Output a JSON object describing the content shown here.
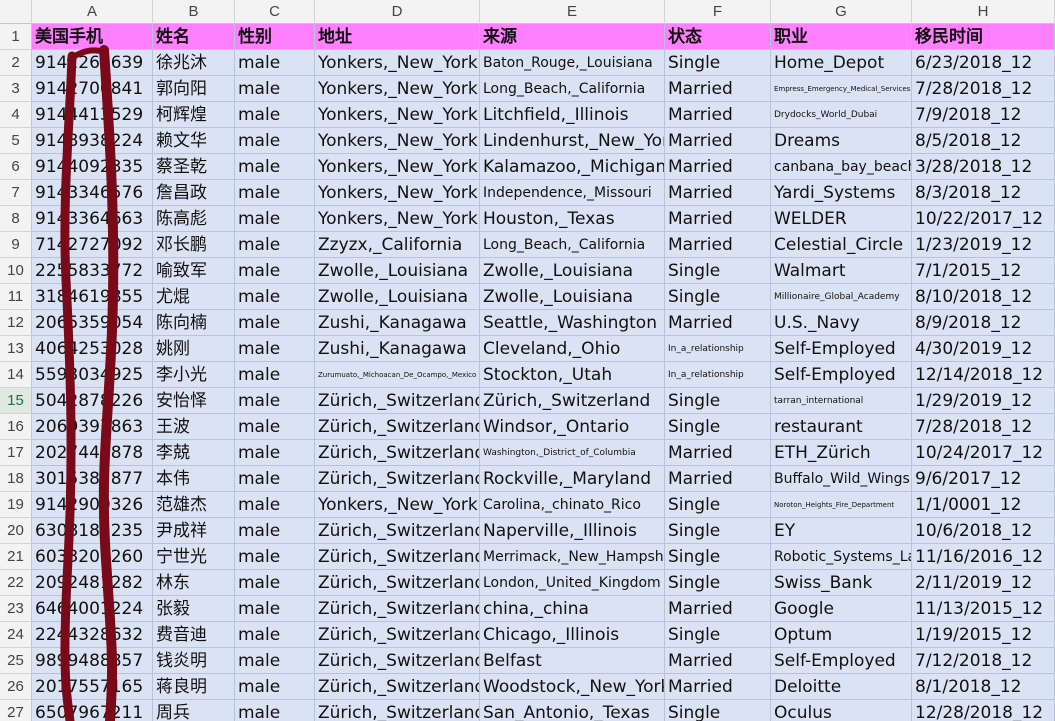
{
  "columns": [
    "A",
    "B",
    "C",
    "D",
    "E",
    "F",
    "G",
    "H"
  ],
  "header": [
    "美国手机",
    "姓名",
    "性别",
    "地址",
    "来源",
    "状态",
    "职业",
    "移民时间"
  ],
  "selected_row": 15,
  "redaction_color": "#7a0a1a",
  "rows": [
    [
      "9142264639",
      "徐兆沐",
      "male",
      "Yonkers,_New_York",
      "Baton_Rouge,_Louisiana",
      "Single",
      "Home_Depot",
      "6/23/2018_12"
    ],
    [
      "9142700841",
      "郭向阳",
      "male",
      "Yonkers,_New_York",
      "Long_Beach,_California",
      "Married",
      "Empress_Emergency_Medical_Services",
      "7/28/2018_12"
    ],
    [
      "9144413529",
      "柯辉煌",
      "male",
      "Yonkers,_New_York",
      "Litchfield,_Illinois",
      "Married",
      "Drydocks_World_Dubai",
      "7/9/2018_12"
    ],
    [
      "9148938224",
      "赖文华",
      "male",
      "Yonkers,_New_York",
      "Lindenhurst,_New_York",
      "Married",
      "Dreams",
      "8/5/2018_12"
    ],
    [
      "9144092335",
      "蔡圣乾",
      "male",
      "Yonkers,_New_York",
      "Kalamazoo,_Michigan",
      "Married",
      "canbana_bay_beach",
      "3/28/2018_12"
    ],
    [
      "9143346576",
      "詹昌政",
      "male",
      "Yonkers,_New_York",
      "Independence,_Missouri",
      "Married",
      "Yardi_Systems",
      "8/3/2018_12"
    ],
    [
      "9143364663",
      "陈高彪",
      "male",
      "Yonkers,_New_York",
      "Houston,_Texas",
      "Married",
      "WELDER",
      "10/22/2017_12"
    ],
    [
      "7142727092",
      "邓长鹏",
      "male",
      "Zzyzx,_California",
      "Long_Beach,_California",
      "Married",
      "Celestial_Circle",
      "1/23/2019_12"
    ],
    [
      "2255833772",
      "喻致军",
      "male",
      "Zwolle,_Louisiana",
      "Zwolle,_Louisiana",
      "Single",
      "Walmart",
      "7/1/2015_12"
    ],
    [
      "3184619855",
      "尤焜",
      "male",
      "Zwolle,_Louisiana",
      "Zwolle,_Louisiana",
      "Single",
      "Millionaire_Global_Academy",
      "8/10/2018_12"
    ],
    [
      "2065359054",
      "陈向楠",
      "male",
      "Zushi,_Kanagawa",
      "Seattle,_Washington",
      "Married",
      "U.S._Navy",
      "8/9/2018_12"
    ],
    [
      "4064253028",
      "姚刚",
      "male",
      "Zushi,_Kanagawa",
      "Cleveland,_Ohio",
      "In_a_relationship",
      "Self-Employed",
      "4/30/2019_12"
    ],
    [
      "5593034925",
      "李小光",
      "male",
      "Zurumuato,_Michoacan_De_Ocampo,_Mexico",
      "Stockton,_Utah",
      "In_a_relationship",
      "Self-Employed",
      "12/14/2018_12"
    ],
    [
      "5042878226",
      "安怡怿",
      "male",
      "Zürich,_Switzerland",
      "Zürich,_Switzerland",
      "Single",
      "tarran_international",
      "1/29/2019_12"
    ],
    [
      "2069397863",
      "王波",
      "male",
      "Zürich,_Switzerland",
      "Windsor,_Ontario",
      "Single",
      "restaurant",
      "7/28/2018_12"
    ],
    [
      "2027443878",
      "李兢",
      "male",
      "Zürich,_Switzerland",
      "Washington,_District_of_Columbia",
      "Married",
      "ETH_Zürich",
      "10/24/2017_12"
    ],
    [
      "3015385877",
      "本伟",
      "male",
      "Zürich,_Switzerland",
      "Rockville,_Maryland",
      "Married",
      "Buffalo_Wild_Wings",
      "9/6/2017_12"
    ],
    [
      "9142900326",
      "范雄杰",
      "male",
      "Yonkers,_New_York",
      "Carolina,_chinato_Rico",
      "Single",
      "Noroton_Heights_Fire_Department",
      "1/1/0001_12"
    ],
    [
      "6308186235",
      "尹成祥",
      "male",
      "Zürich,_Switzerland",
      "Naperville,_Illinois",
      "Single",
      "EY",
      "10/6/2018_12"
    ],
    [
      "6033209260",
      "宁世光",
      "male",
      "Zürich,_Switzerland",
      "Merrimack,_New_Hampshire",
      "Single",
      "Robotic_Systems_Lab",
      "11/16/2016_12"
    ],
    [
      "2092481282",
      "林东",
      "male",
      "Zürich,_Switzerland",
      "London,_United_Kingdom",
      "Single",
      "Swiss_Bank",
      "2/11/2019_12"
    ],
    [
      "6464001224",
      "张毅",
      "male",
      "Zürich,_Switzerland",
      "china,_china",
      "Married",
      "Google",
      "11/13/2015_12"
    ],
    [
      "2244328632",
      "费音迪",
      "male",
      "Zürich,_Switzerland",
      "Chicago,_Illinois",
      "Single",
      "Optum",
      "1/19/2015_12"
    ],
    [
      "9899488857",
      "钱炎明",
      "male",
      "Zürich,_Switzerland",
      "Belfast",
      "Married",
      "Self-Employed",
      "7/12/2018_12"
    ],
    [
      "2017557165",
      "蒋良明",
      "male",
      "Zürich,_Switzerland",
      "Woodstock,_New_York",
      "Married",
      "Deloitte",
      "8/1/2018_12"
    ],
    [
      "6507967211",
      "周兵",
      "male",
      "Zürich,_Switzerland",
      "San_Antonio,_Texas",
      "Single",
      "Oculus",
      "12/28/2018_12"
    ]
  ]
}
